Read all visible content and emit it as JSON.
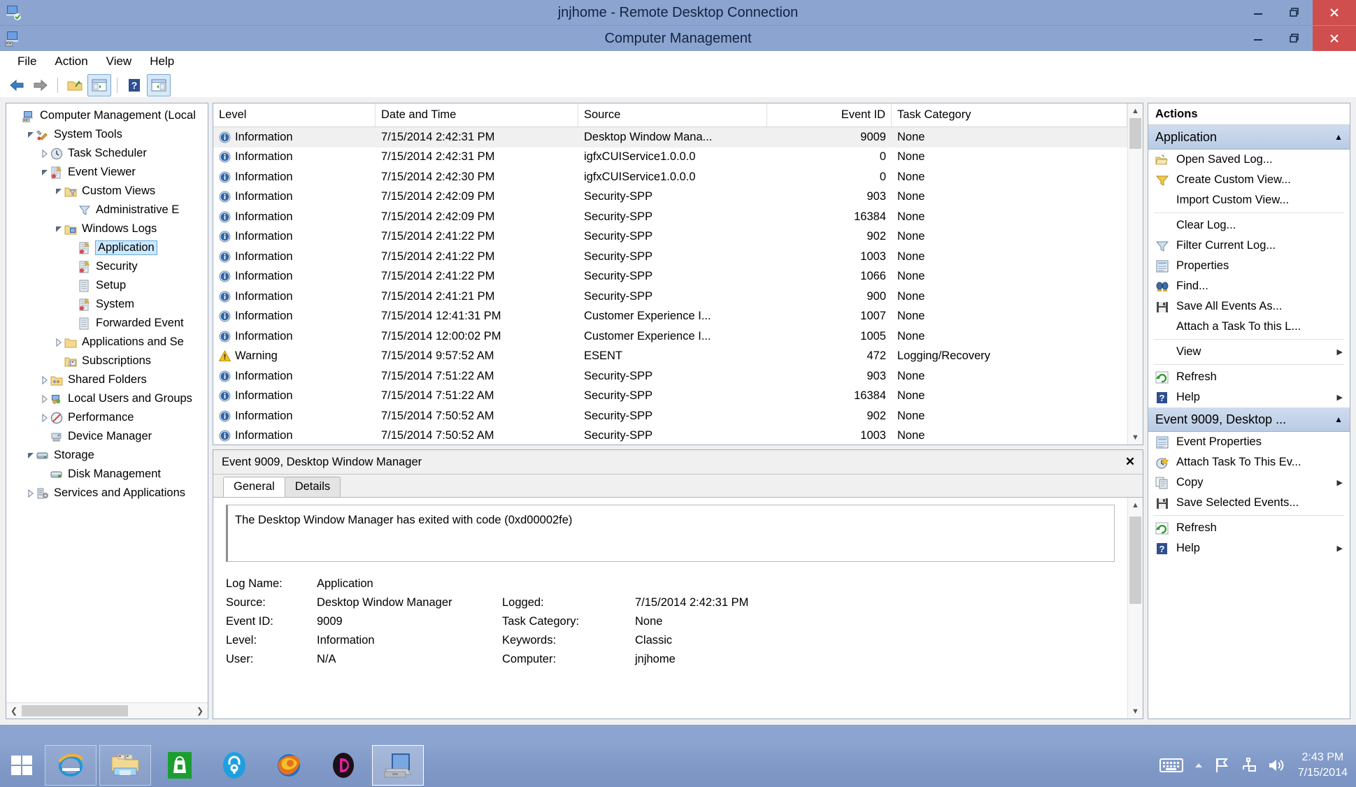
{
  "rdp": {
    "title": "jnjhome - Remote Desktop Connection",
    "minimize": "–",
    "maximize": "❐",
    "close": "✕"
  },
  "cm": {
    "title": "Computer Management",
    "minimize": "–",
    "maximize": "❐",
    "close": "✕"
  },
  "menubar": [
    "File",
    "Action",
    "View",
    "Help"
  ],
  "toolbar": {
    "back": "back-arrow",
    "forward": "forward-arrow",
    "up_folder": "up-one-level",
    "show_tree": "show-hide-tree",
    "help": "help",
    "show_action_pane": "show-hide-action-pane"
  },
  "tree": [
    {
      "label": "Computer Management (Local",
      "depth": 0,
      "twisty": "",
      "icon": "computer",
      "selected": false
    },
    {
      "label": "System Tools",
      "depth": 1,
      "twisty": "expanded",
      "icon": "tools",
      "selected": false
    },
    {
      "label": "Task Scheduler",
      "depth": 2,
      "twisty": "collapsed",
      "icon": "clock",
      "selected": false
    },
    {
      "label": "Event Viewer",
      "depth": 2,
      "twisty": "expanded",
      "icon": "eventlog",
      "selected": false
    },
    {
      "label": "Custom Views",
      "depth": 3,
      "twisty": "expanded",
      "icon": "folder-filter",
      "selected": false
    },
    {
      "label": "Administrative E",
      "depth": 4,
      "twisty": "",
      "icon": "filter",
      "selected": false
    },
    {
      "label": "Windows Logs",
      "depth": 3,
      "twisty": "expanded",
      "icon": "folder-logs",
      "selected": false
    },
    {
      "label": "Application",
      "depth": 4,
      "twisty": "",
      "icon": "eventlog",
      "selected": true
    },
    {
      "label": "Security",
      "depth": 4,
      "twisty": "",
      "icon": "eventlog",
      "selected": false
    },
    {
      "label": "Setup",
      "depth": 4,
      "twisty": "",
      "icon": "log",
      "selected": false
    },
    {
      "label": "System",
      "depth": 4,
      "twisty": "",
      "icon": "eventlog",
      "selected": false
    },
    {
      "label": "Forwarded Event",
      "depth": 4,
      "twisty": "",
      "icon": "log",
      "selected": false
    },
    {
      "label": "Applications and Se",
      "depth": 3,
      "twisty": "collapsed",
      "icon": "folder",
      "selected": false
    },
    {
      "label": "Subscriptions",
      "depth": 3,
      "twisty": "",
      "icon": "folder-sub",
      "selected": false
    },
    {
      "label": "Shared Folders",
      "depth": 2,
      "twisty": "collapsed",
      "icon": "shared",
      "selected": false
    },
    {
      "label": "Local Users and Groups",
      "depth": 2,
      "twisty": "collapsed",
      "icon": "users",
      "selected": false
    },
    {
      "label": "Performance",
      "depth": 2,
      "twisty": "collapsed",
      "icon": "perf",
      "selected": false
    },
    {
      "label": "Device Manager",
      "depth": 2,
      "twisty": "",
      "icon": "device",
      "selected": false
    },
    {
      "label": "Storage",
      "depth": 1,
      "twisty": "expanded",
      "icon": "storage",
      "selected": false
    },
    {
      "label": "Disk Management",
      "depth": 2,
      "twisty": "",
      "icon": "disk",
      "selected": false
    },
    {
      "label": "Services and Applications",
      "depth": 1,
      "twisty": "collapsed",
      "icon": "services",
      "selected": false
    }
  ],
  "event_list": {
    "columns": [
      "Level",
      "Date and Time",
      "Source",
      "Event ID",
      "Task Category"
    ],
    "rows": [
      {
        "level": "Information",
        "icon": "info",
        "date": "7/15/2014 2:42:31 PM",
        "source": "Desktop Window Mana...",
        "event_id": "9009",
        "task": "None",
        "selected": true
      },
      {
        "level": "Information",
        "icon": "info",
        "date": "7/15/2014 2:42:31 PM",
        "source": "igfxCUIService1.0.0.0",
        "event_id": "0",
        "task": "None",
        "selected": false
      },
      {
        "level": "Information",
        "icon": "info",
        "date": "7/15/2014 2:42:30 PM",
        "source": "igfxCUIService1.0.0.0",
        "event_id": "0",
        "task": "None",
        "selected": false
      },
      {
        "level": "Information",
        "icon": "info",
        "date": "7/15/2014 2:42:09 PM",
        "source": "Security-SPP",
        "event_id": "903",
        "task": "None",
        "selected": false
      },
      {
        "level": "Information",
        "icon": "info",
        "date": "7/15/2014 2:42:09 PM",
        "source": "Security-SPP",
        "event_id": "16384",
        "task": "None",
        "selected": false
      },
      {
        "level": "Information",
        "icon": "info",
        "date": "7/15/2014 2:41:22 PM",
        "source": "Security-SPP",
        "event_id": "902",
        "task": "None",
        "selected": false
      },
      {
        "level": "Information",
        "icon": "info",
        "date": "7/15/2014 2:41:22 PM",
        "source": "Security-SPP",
        "event_id": "1003",
        "task": "None",
        "selected": false
      },
      {
        "level": "Information",
        "icon": "info",
        "date": "7/15/2014 2:41:22 PM",
        "source": "Security-SPP",
        "event_id": "1066",
        "task": "None",
        "selected": false
      },
      {
        "level": "Information",
        "icon": "info",
        "date": "7/15/2014 2:41:21 PM",
        "source": "Security-SPP",
        "event_id": "900",
        "task": "None",
        "selected": false
      },
      {
        "level": "Information",
        "icon": "info",
        "date": "7/15/2014 12:41:31 PM",
        "source": "Customer Experience I...",
        "event_id": "1007",
        "task": "None",
        "selected": false
      },
      {
        "level": "Information",
        "icon": "info",
        "date": "7/15/2014 12:00:02 PM",
        "source": "Customer Experience I...",
        "event_id": "1005",
        "task": "None",
        "selected": false
      },
      {
        "level": "Warning",
        "icon": "warning",
        "date": "7/15/2014 9:57:52 AM",
        "source": "ESENT",
        "event_id": "472",
        "task": "Logging/Recovery",
        "selected": false
      },
      {
        "level": "Information",
        "icon": "info",
        "date": "7/15/2014 7:51:22 AM",
        "source": "Security-SPP",
        "event_id": "903",
        "task": "None",
        "selected": false
      },
      {
        "level": "Information",
        "icon": "info",
        "date": "7/15/2014 7:51:22 AM",
        "source": "Security-SPP",
        "event_id": "16384",
        "task": "None",
        "selected": false
      },
      {
        "level": "Information",
        "icon": "info",
        "date": "7/15/2014 7:50:52 AM",
        "source": "Security-SPP",
        "event_id": "902",
        "task": "None",
        "selected": false
      },
      {
        "level": "Information",
        "icon": "info",
        "date": "7/15/2014 7:50:52 AM",
        "source": "Security-SPP",
        "event_id": "1003",
        "task": "None",
        "selected": false
      }
    ]
  },
  "detail": {
    "title": "Event 9009, Desktop Window Manager",
    "close": "✕",
    "tabs": [
      {
        "label": "General",
        "active": true
      },
      {
        "label": "Details",
        "active": false
      }
    ],
    "message": "The Desktop Window Manager has exited with code (0xd00002fe)",
    "fields": [
      {
        "k": "Log Name:",
        "v": "Application",
        "k2": "",
        "v2": ""
      },
      {
        "k": "Source:",
        "v": "Desktop Window Manager",
        "k2": "Logged:",
        "v2": "7/15/2014 2:42:31 PM"
      },
      {
        "k": "Event ID:",
        "v": "9009",
        "k2": "Task Category:",
        "v2": "None"
      },
      {
        "k": "Level:",
        "v": "Information",
        "k2": "Keywords:",
        "v2": "Classic"
      },
      {
        "k": "User:",
        "v": "N/A",
        "k2": "Computer:",
        "v2": "jnjhome"
      }
    ]
  },
  "actions": {
    "header": "Actions",
    "groups": [
      {
        "title": "Application",
        "collapse": "▲",
        "items": [
          {
            "label": "Open Saved Log...",
            "icon": "open-folder",
            "sub": ""
          },
          {
            "label": "Create Custom View...",
            "icon": "filter-gold",
            "sub": ""
          },
          {
            "label": "Import Custom View...",
            "icon": "",
            "sub": ""
          },
          {
            "sep": true
          },
          {
            "label": "Clear Log...",
            "icon": "",
            "sub": ""
          },
          {
            "label": "Filter Current Log...",
            "icon": "filter",
            "sub": ""
          },
          {
            "label": "Properties",
            "icon": "properties",
            "sub": ""
          },
          {
            "label": "Find...",
            "icon": "find",
            "sub": ""
          },
          {
            "label": "Save All Events As...",
            "icon": "save",
            "sub": ""
          },
          {
            "label": "Attach a Task To this L...",
            "icon": "",
            "sub": ""
          },
          {
            "sep": true
          },
          {
            "label": "View",
            "icon": "",
            "sub": "▶"
          },
          {
            "sep": true
          },
          {
            "label": "Refresh",
            "icon": "refresh",
            "sub": ""
          },
          {
            "label": "Help",
            "icon": "help",
            "sub": "▶"
          }
        ]
      },
      {
        "title": "Event 9009, Desktop ...",
        "collapse": "▲",
        "items": [
          {
            "label": "Event Properties",
            "icon": "properties",
            "sub": ""
          },
          {
            "label": "Attach Task To This Ev...",
            "icon": "attach-task",
            "sub": ""
          },
          {
            "label": "Copy",
            "icon": "copy",
            "sub": "▶"
          },
          {
            "label": "Save Selected Events...",
            "icon": "save",
            "sub": ""
          },
          {
            "sep": true
          },
          {
            "label": "Refresh",
            "icon": "refresh",
            "sub": ""
          },
          {
            "label": "Help",
            "icon": "help",
            "sub": "▶"
          }
        ]
      }
    ]
  },
  "taskbar": {
    "start": "windows-logo",
    "apps": [
      {
        "name": "internet-explorer",
        "state": "pinned"
      },
      {
        "name": "file-explorer",
        "state": "pinned"
      },
      {
        "name": "windows-store",
        "state": "normal"
      },
      {
        "name": "password-manager",
        "state": "normal"
      },
      {
        "name": "firefox",
        "state": "normal"
      },
      {
        "name": "media-player",
        "state": "normal"
      },
      {
        "name": "remote-desktop",
        "state": "active"
      }
    ],
    "tray": [
      "keyboard",
      "show-hidden-icons",
      "action-center-flag",
      "network",
      "volume"
    ],
    "time": "2:43 PM",
    "date": "7/15/2014"
  },
  "colors": {
    "titlebar": "#8ba4d0",
    "close_button": "#cf4f4f",
    "selection": "#cce8ff",
    "actions_group": "#c3d4ea"
  }
}
